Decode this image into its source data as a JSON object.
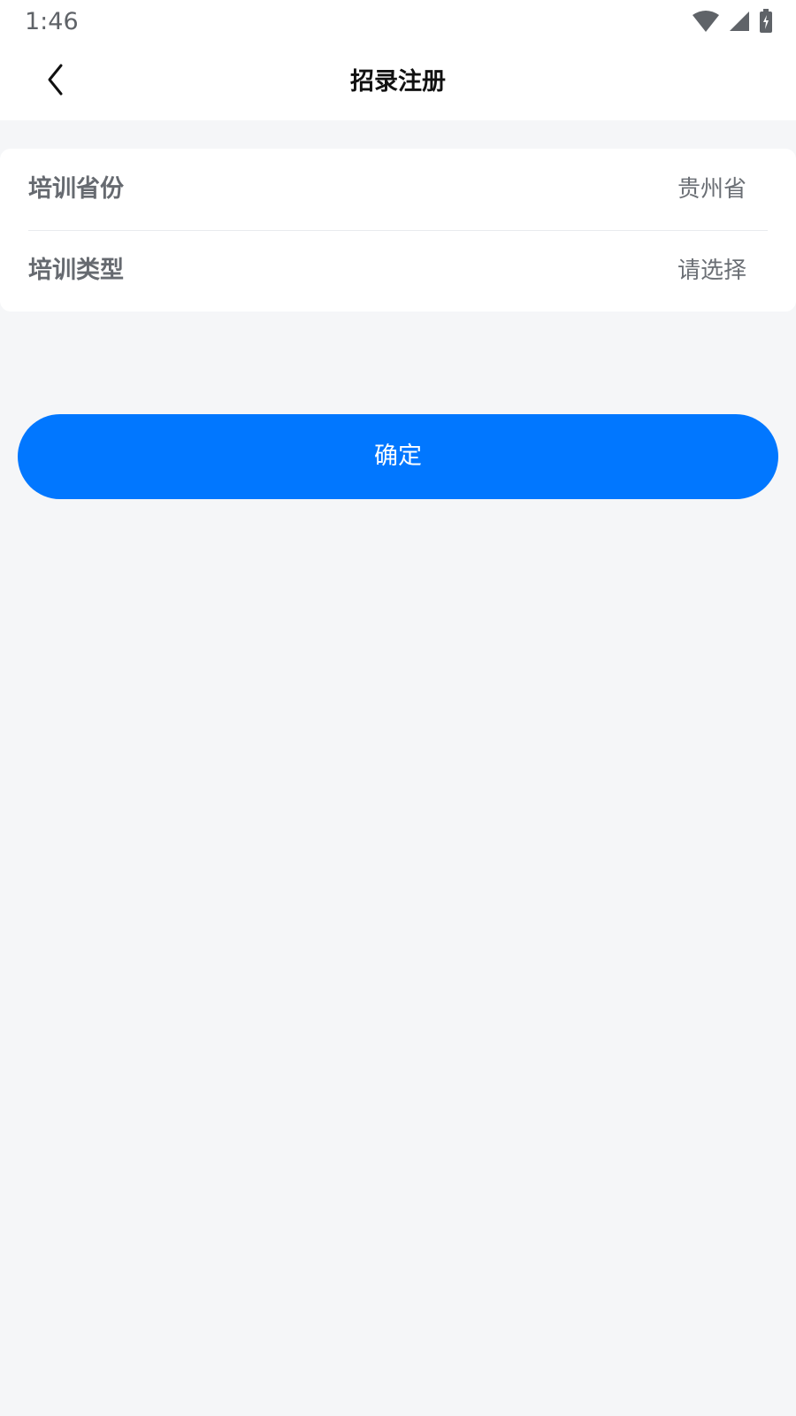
{
  "status_bar": {
    "time": "1:46",
    "icons": [
      "wifi-icon",
      "signal-icon",
      "battery-charging-icon"
    ]
  },
  "header": {
    "title": "招录注册",
    "back_icon": "chevron-left-icon"
  },
  "form": {
    "rows": [
      {
        "label": "培训省份",
        "value": "贵州省"
      },
      {
        "label": "培训类型",
        "value": "请选择"
      }
    ]
  },
  "confirm_button": {
    "label": "确定"
  },
  "colors": {
    "accent": "#0177ff",
    "background": "#f5f6f8",
    "card": "#ffffff"
  }
}
